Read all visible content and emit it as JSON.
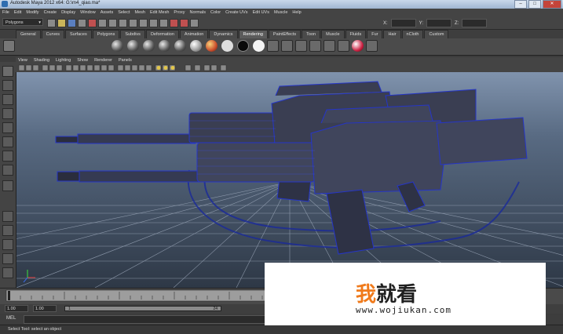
{
  "window": {
    "title": "Autodesk Maya 2012 x64: G:\\m4_qiao.ma*",
    "minimize": "–",
    "maximize": "□",
    "close": "✕"
  },
  "menubar": [
    "File",
    "Edit",
    "Modify",
    "Create",
    "Display",
    "Window",
    "Assets",
    "Select",
    "Mesh",
    "Edit Mesh",
    "Proxy",
    "Normals",
    "Color",
    "Create UVs",
    "Edit UVs",
    "Muscle",
    "Help"
  ],
  "statusline": {
    "menuset": "Polygons",
    "x_label": "X:",
    "y_label": "Y:",
    "z_label": "Z:"
  },
  "shelf_tabs": [
    "General",
    "Curves",
    "Surfaces",
    "Polygons",
    "Subdivs",
    "Deformation",
    "Animation",
    "Dynamics",
    "Rendering",
    "PaintEffects",
    "Toon",
    "Muscle",
    "Fluids",
    "Fur",
    "Hair",
    "nCloth",
    "Custom"
  ],
  "active_shelf_tab": "Rendering",
  "panel_menu": [
    "View",
    "Shading",
    "Lighting",
    "Show",
    "Renderer",
    "Panels"
  ],
  "range": {
    "start": "1.00",
    "playback_start": "1.00",
    "range_start_label": "1",
    "range_end_label": "24"
  },
  "command_line": {
    "label": "MEL"
  },
  "help_line": {
    "text": "Select Tool: select an object"
  },
  "watermark": {
    "cn_first": "我",
    "cn_rest": "就看",
    "url": "www.wojiukan.com"
  }
}
